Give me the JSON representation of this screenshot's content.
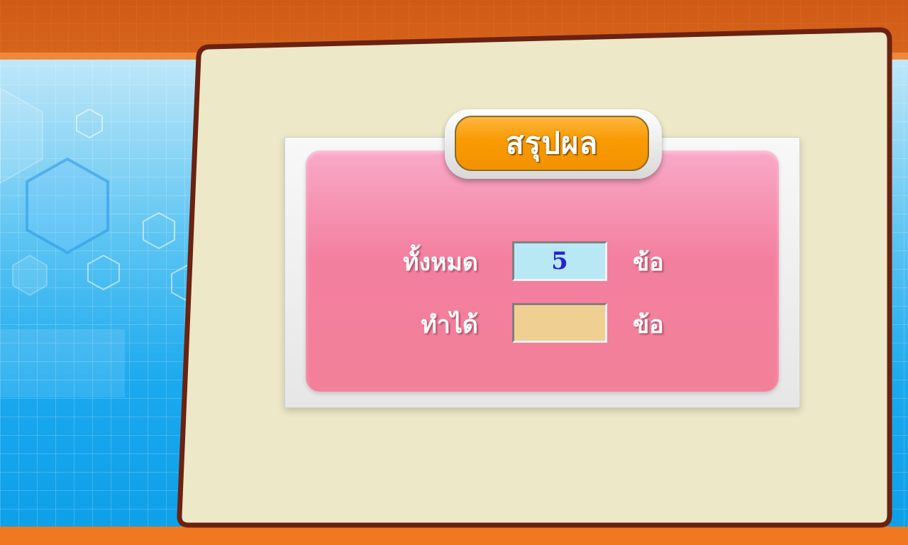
{
  "summary": {
    "title": "สรุปผล",
    "total_label": "ทั้งหมด",
    "total_value": "5",
    "total_unit": "ข้อ",
    "score_label": "ทำได้",
    "score_value": "",
    "score_unit": "ข้อ"
  },
  "colors": {
    "orange_band": "#d8651b",
    "card_fill": "#ece8c8",
    "card_border": "#6b2210",
    "panel_pink": "#f37f9f",
    "title_orange": "#f89a00",
    "total_box": "#b9e8f5",
    "score_box": "#f0cf92",
    "value_text": "#2323d6"
  }
}
